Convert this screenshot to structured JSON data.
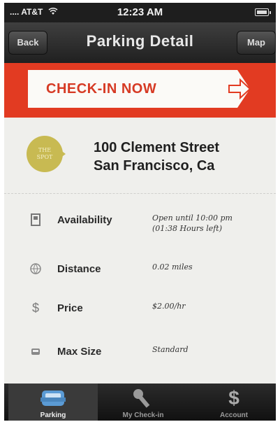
{
  "status_bar": {
    "carrier": "AT&T",
    "time": "12:23 AM"
  },
  "navbar": {
    "title": "Parking Detail",
    "back_label": "Back",
    "map_label": "Map"
  },
  "banner": {
    "checkin_label": "CHECK-IN NOW"
  },
  "spot": {
    "logo_text_1": "THE",
    "logo_text_2": "SPOT",
    "address_line1": "100 Clement Street",
    "address_line2": "San Francisco, Ca"
  },
  "details": [
    {
      "label": "Availability",
      "value_1": "Open until 10:00 pm",
      "value_2": "(01:38 Hours left)",
      "icon": "door-icon"
    },
    {
      "label": "Distance",
      "value_1": "0.02 miles",
      "value_2": "",
      "icon": "globe-icon"
    },
    {
      "label": "Price",
      "value_1": "$2.00/hr",
      "value_2": "",
      "icon": "dollar-icon"
    },
    {
      "label": "Max Size",
      "value_1": "Standard",
      "value_2": "",
      "icon": "car-icon"
    }
  ],
  "tabs": [
    {
      "label": "Parking",
      "icon": "car-icon"
    },
    {
      "label": "My Check-in",
      "icon": "key-icon"
    },
    {
      "label": "Account",
      "icon": "dollar-icon"
    }
  ],
  "colors": {
    "banner_red": "#e23b22",
    "logo_gold": "#c8ba52",
    "nav_dark": "#2a2a2a"
  }
}
